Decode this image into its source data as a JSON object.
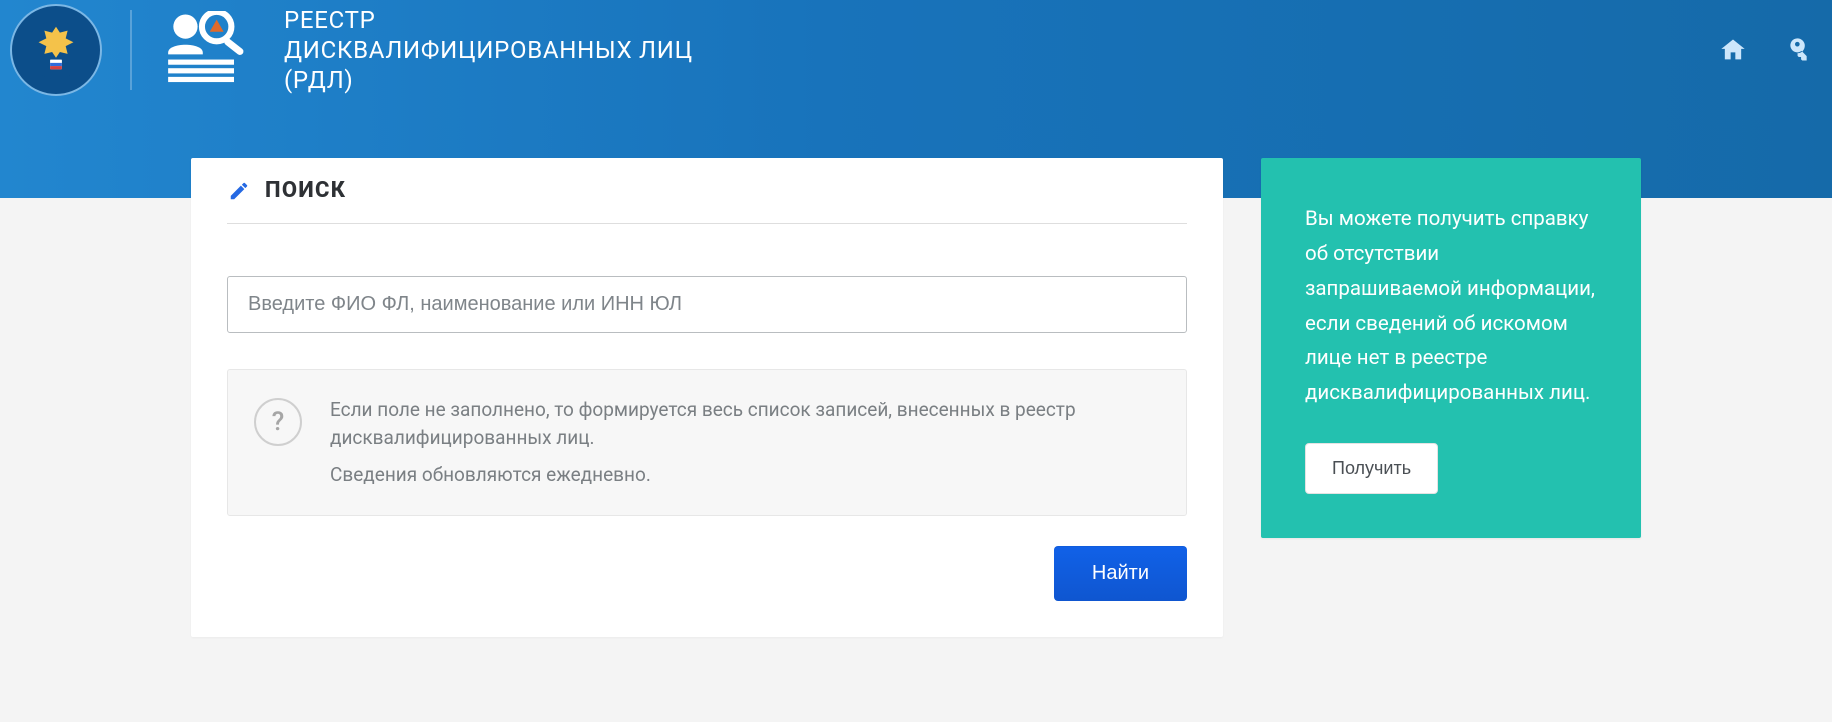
{
  "header": {
    "title": "РЕЕСТР ДИСКВАЛИФИЦИРОВАННЫХ ЛИЦ (РДЛ)"
  },
  "search": {
    "heading": "ПОИСК",
    "placeholder": "Введите ФИО ФЛ, наименование или ИНН ЮЛ",
    "hint_line1": "Если поле не заполнено, то формируется весь список записей, внесенных в реестр дисквалифицированных лиц.",
    "hint_line2": "Сведения обновляются ежедневно.",
    "submit_label": "Найти"
  },
  "sidebar": {
    "info_text": "Вы можете получить справку об отсутствии запрашиваемой информации, если сведений об искомом лице нет в реестре дисквалифицированных лиц.",
    "cta_label": "Получить"
  },
  "icons": {
    "hint_mark": "?"
  }
}
